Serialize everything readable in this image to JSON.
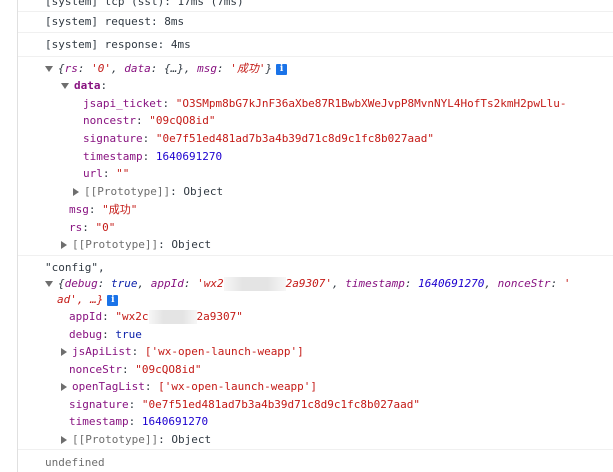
{
  "system_logs": [
    "[system] tcp (ssl): 17ms (7ms)",
    "[system] request: 8ms",
    "[system] response: 4ms"
  ],
  "response": {
    "preview_open": "{",
    "preview_rs_key": "rs",
    "preview_rs_val": "'0'",
    "preview_data_key": "data",
    "preview_data_val": "{…}",
    "preview_msg_key": "msg",
    "preview_msg_val": "'成功'",
    "preview_close": "}",
    "data_key": "data",
    "jsapi_ticket_key": "jsapi_ticket",
    "jsapi_ticket_val": "\"O3SMpm8bG7kJnF36aXbe87R1BwbXWeJvpP8MvnNYL4HofTs2kmH2pwLlu-",
    "noncestr_key": "noncestr",
    "noncestr_val": "\"09cQO8id\"",
    "signature_key": "signature",
    "signature_val": "\"0e7f51ed481ad7b3a4b39d71c8d9c1fc8b027aad\"",
    "timestamp_key": "timestamp",
    "timestamp_val": "1640691270",
    "url_key": "url",
    "url_val": "\"\"",
    "prototype_label": "[[Prototype]]",
    "prototype_val": "Object",
    "msg_key": "msg",
    "msg_val": "\"成功\"",
    "rs_key": "rs",
    "rs_val": "\"0\""
  },
  "config": {
    "label": "\"config\",",
    "preview_open": "{",
    "preview_debug_key": "debug",
    "preview_debug_val": "true",
    "preview_appid_key": "appId",
    "preview_appid_prefix": "'wx2",
    "preview_appid_suffix": "2a9307'",
    "preview_ts_key": "timestamp",
    "preview_ts_val": "1640691270",
    "preview_nonce_key": "nonceStr",
    "preview_nonce_val": "'",
    "preview_line2": "ad', …}",
    "appid_key": "appId",
    "appid_prefix": "\"wx2c",
    "appid_suffix": "2a9307\"",
    "debug_key": "debug",
    "debug_val": "true",
    "jsapilist_key": "jsApiList",
    "jsapilist_val": "['wx-open-launch-weapp']",
    "noncestr_key": "nonceStr",
    "noncestr_val": "\"09cQO8id\"",
    "opentaglist_key": "openTagList",
    "opentaglist_val": "['wx-open-launch-weapp']",
    "signature_key": "signature",
    "signature_val": "\"0e7f51ed481ad7b3a4b39d71c8d9c1fc8b027aad\"",
    "timestamp_key": "timestamp",
    "timestamp_val": "1640691270",
    "prototype_label": "[[Prototype]]",
    "prototype_val": "Object"
  },
  "result": "undefined",
  "icons": {
    "info": "i"
  }
}
